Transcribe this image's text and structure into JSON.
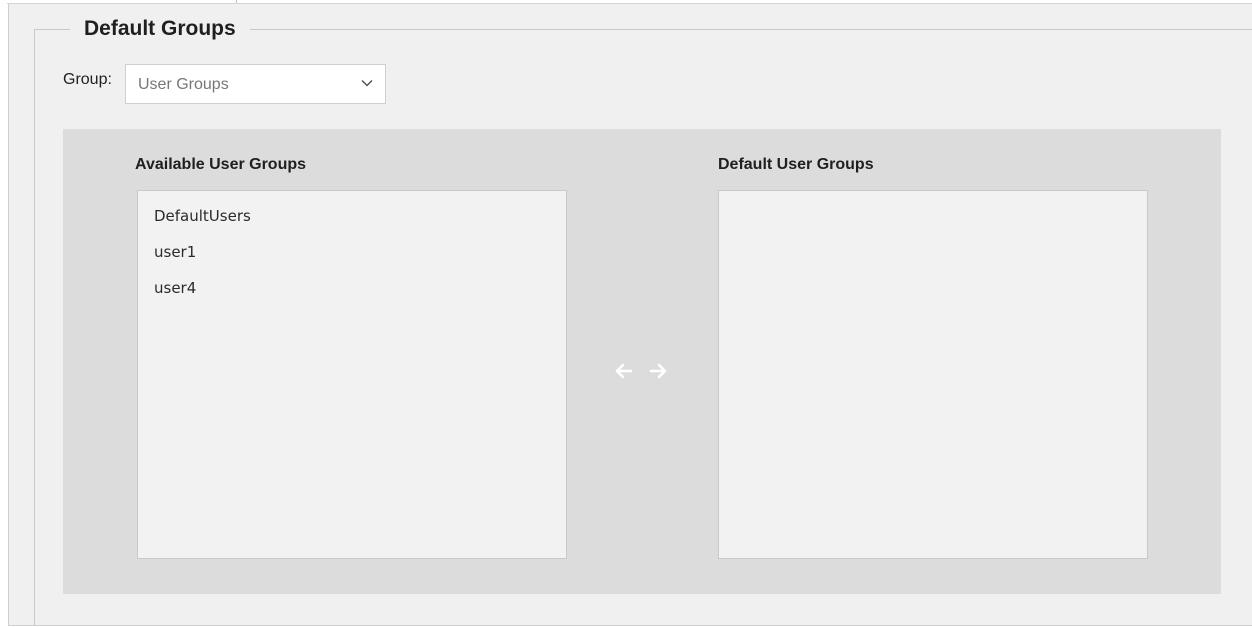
{
  "section": {
    "title": "Default Groups"
  },
  "group_selector": {
    "label": "Group:",
    "selected": "User Groups",
    "icon": "chevron-down-icon"
  },
  "available": {
    "title": "Available User Groups",
    "items": [
      "DefaultUsers",
      "user1",
      "user4"
    ]
  },
  "defaults": {
    "title": "Default User Groups",
    "items": []
  },
  "transfer": {
    "left_icon": "arrow-left-icon",
    "right_icon": "arrow-right-icon"
  },
  "colors": {
    "fieldset_bg": "#f0f0f0",
    "panel_bg": "#dcdcdc",
    "list_bg": "#f2f2f2",
    "arrow": "#ffffff"
  }
}
